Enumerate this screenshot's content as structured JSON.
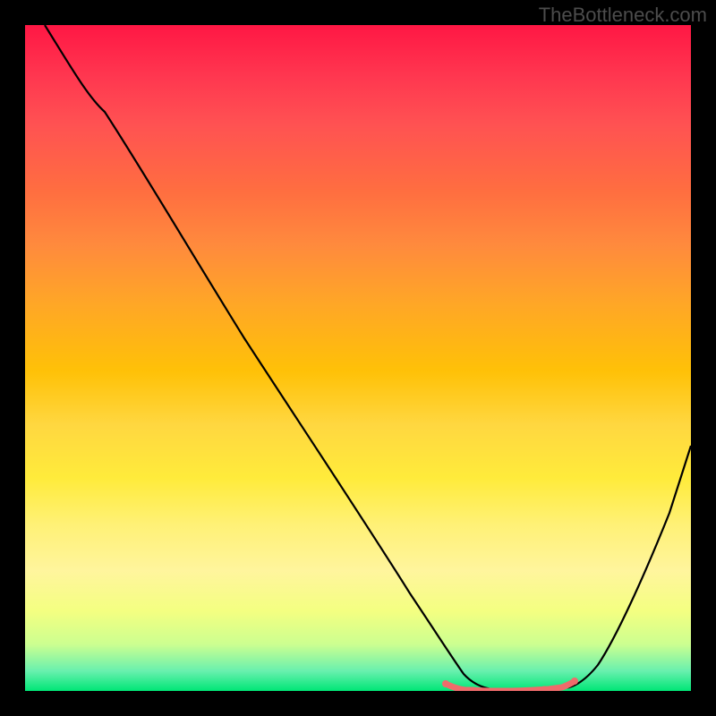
{
  "watermark": "TheBottleneck.com",
  "chart_data": {
    "type": "line",
    "title": "",
    "xlabel": "",
    "ylabel": "",
    "xlim": [
      0,
      100
    ],
    "ylim": [
      0,
      100
    ],
    "series": [
      {
        "name": "curve",
        "x": [
          3,
          8,
          12,
          18,
          25,
          32,
          40,
          48,
          55,
          60,
          63,
          65,
          68,
          70,
          73,
          76,
          79,
          82,
          84,
          86,
          90,
          95,
          100
        ],
        "y": [
          100,
          93,
          87,
          78,
          67,
          56,
          44,
          32,
          21,
          13,
          8,
          5,
          2,
          1,
          0,
          0,
          0,
          1,
          2,
          4,
          10,
          22,
          38
        ]
      }
    ],
    "highlight_segment": {
      "name": "bottom-marker",
      "color": "#e57373",
      "x_start": 63,
      "x_end": 82,
      "y": 0
    },
    "gradient_colors": {
      "top": "#ff1744",
      "middle": "#ffd740",
      "bottom": "#00e676"
    }
  }
}
